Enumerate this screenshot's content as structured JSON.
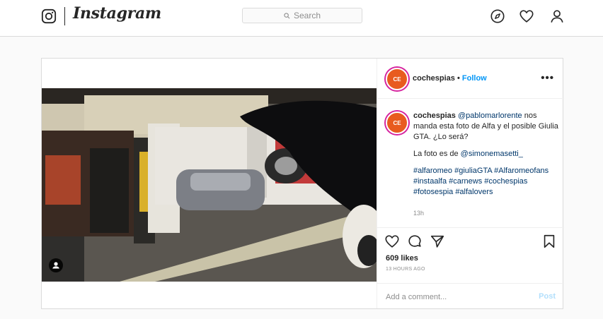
{
  "header": {
    "brand": "Instagram",
    "search_placeholder": "Search",
    "icons": [
      "instagram-logo-icon",
      "explore-compass-icon",
      "activity-heart-icon",
      "profile-icon"
    ]
  },
  "post": {
    "author": "cochespias",
    "separator": "•",
    "follow_label": "Follow",
    "more_icon": "more-options-icon",
    "more_label": "•••",
    "avatar_text": "CE\nSP",
    "caption": {
      "author": "cochespias",
      "mention1": "@pablomarlorente",
      "text1": "nos manda esta foto de Alfa y el posible Giulia GTA. ¿Lo será?",
      "text2": "La foto es de",
      "mention2": "@simonemasetti_",
      "hashtags": "#alfaromeo #giuliaGTA #Alfaromeofans #instaalfa #carnews #cochespias #fotosespia #alfalovers"
    },
    "comment_time": "13h",
    "likes": "609 likes",
    "posted": "13 HOURS AGO",
    "comment_placeholder": "Add a comment...",
    "post_label": "Post"
  },
  "colors": {
    "link_blue": "#0095f6",
    "mention_blue": "#00376b",
    "border": "#dbdbdb",
    "muted": "#8e8e8e",
    "post_disabled": "#b2dffc"
  }
}
